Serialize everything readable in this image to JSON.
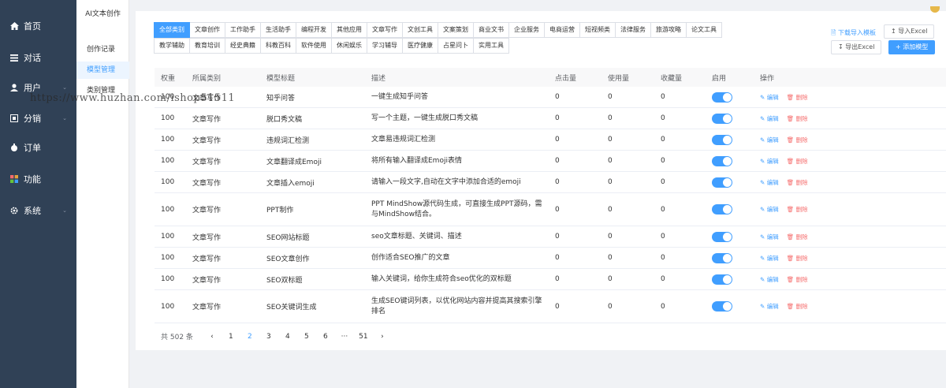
{
  "nav": [
    {
      "label": "首页",
      "icon": "home-icon"
    },
    {
      "label": "对话",
      "icon": "list-icon"
    },
    {
      "label": "用户",
      "icon": "user-icon"
    },
    {
      "label": "分销",
      "icon": "share-icon"
    },
    {
      "label": "订单",
      "icon": "order-icon"
    },
    {
      "label": "功能",
      "icon": "apps-icon"
    },
    {
      "label": "系统",
      "icon": "gear-icon"
    }
  ],
  "submenu": {
    "title": "AI文本创作",
    "items": [
      "创作记录",
      "模型管理",
      "类别管理"
    ]
  },
  "tabs": {
    "row1": [
      "全部类别",
      "文章创作",
      "工作助手",
      "生活助手",
      "编程开发",
      "其他应用",
      "文章写作",
      "文创工具",
      "文案策划",
      "商业文书",
      "企业服务",
      "电商运营",
      "短视频类",
      "法律服务",
      "旅游攻略",
      "论文工具"
    ],
    "row2": [
      "教学辅助",
      "教育培训",
      "经史典籍",
      "科教百科",
      "软件使用",
      "休闲娱乐",
      "学习辅导",
      "医疗健康",
      "占星问卜",
      "实用工具"
    ]
  },
  "actions": {
    "download_template": "下载导入模板",
    "import_excel": "导入Excel",
    "export_excel": "导出Excel",
    "add_model": "添加模型"
  },
  "table": {
    "headers": [
      "权重",
      "所属类别",
      "模型标题",
      "描述",
      "点击量",
      "使用量",
      "收藏量",
      "启用",
      "操作"
    ],
    "edit_label": "编辑",
    "delete_label": "删除",
    "rows": [
      {
        "weight": "100",
        "category": "文章写作",
        "title": "知乎问答",
        "desc": "一键生成知乎问答",
        "clicks": "0",
        "uses": "0",
        "favs": "0"
      },
      {
        "weight": "100",
        "category": "文章写作",
        "title": "脱口秀文稿",
        "desc": "写一个主题，一键生成脱口秀文稿",
        "clicks": "0",
        "uses": "0",
        "favs": "0"
      },
      {
        "weight": "100",
        "category": "文章写作",
        "title": "违规词汇检测",
        "desc": "文章易违规词汇检测",
        "clicks": "0",
        "uses": "0",
        "favs": "0"
      },
      {
        "weight": "100",
        "category": "文章写作",
        "title": "文章翻译成Emoji",
        "desc": "将所有输入翻译成Emoji表情",
        "clicks": "0",
        "uses": "0",
        "favs": "0"
      },
      {
        "weight": "100",
        "category": "文章写作",
        "title": "文章插入emoji",
        "desc": "请输入一段文字,自动在文字中添加合适的emoji",
        "clicks": "0",
        "uses": "0",
        "favs": "0"
      },
      {
        "weight": "100",
        "category": "文章写作",
        "title": "PPT制作",
        "desc": "PPT MindShow源代码生成，可直接生成PPT源码，需与MindShow结合。",
        "clicks": "0",
        "uses": "0",
        "favs": "0"
      },
      {
        "weight": "100",
        "category": "文章写作",
        "title": "SEO网站标题",
        "desc": "seo文章标题、关键词、描述",
        "clicks": "0",
        "uses": "0",
        "favs": "0"
      },
      {
        "weight": "100",
        "category": "文章写作",
        "title": "SEO文章创作",
        "desc": "创作适合SEO推广的文章",
        "clicks": "0",
        "uses": "0",
        "favs": "0"
      },
      {
        "weight": "100",
        "category": "文章写作",
        "title": "SEO双标题",
        "desc": "输入关键词，给你生成符合seo优化的双标题",
        "clicks": "0",
        "uses": "0",
        "favs": "0"
      },
      {
        "weight": "100",
        "category": "文章写作",
        "title": "SEO关键词生成",
        "desc": "生成SEO键词列表，以优化网站内容并提高其搜索引擎排名",
        "clicks": "0",
        "uses": "0",
        "favs": "0"
      }
    ]
  },
  "pagination": {
    "total": "共 502 条",
    "prev": "‹",
    "pages": [
      "1",
      "2",
      "3",
      "4",
      "5",
      "6",
      "···",
      "51"
    ],
    "next": "›"
  },
  "watermark": "https://www.huzhan.com/ishop51511"
}
